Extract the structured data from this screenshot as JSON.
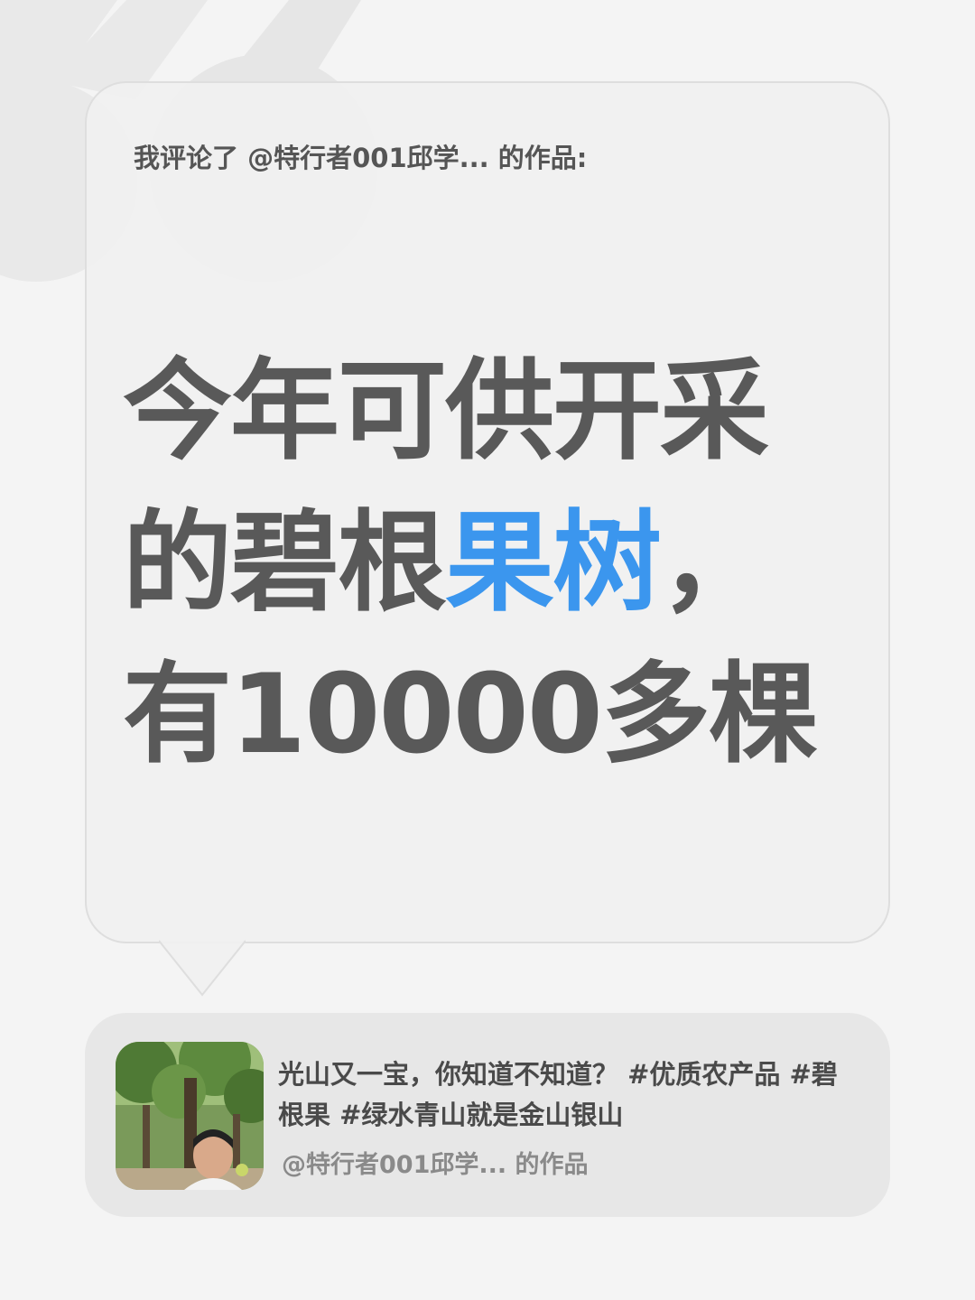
{
  "comment": {
    "header": "我评论了 @特行者001邱学... 的作品:",
    "headline": {
      "line1": "今年可供开采",
      "line2_prefix": "的碧根",
      "line2_highlight": "果树",
      "line2_suffix": "，",
      "line3": "有10000多棵"
    }
  },
  "work_card": {
    "title": "光山又一宝，你知道不知道？ #优质农产品 #碧根果 #绿水青山就是金山银山",
    "author": "@特行者001邱学... 的作品",
    "thumbnail_icon": "person-under-tree-photo"
  },
  "colors": {
    "background": "#f4f4f4",
    "headline_text": "#595959",
    "highlight": "#3b96ee",
    "card_background": "#e7e7e7"
  }
}
